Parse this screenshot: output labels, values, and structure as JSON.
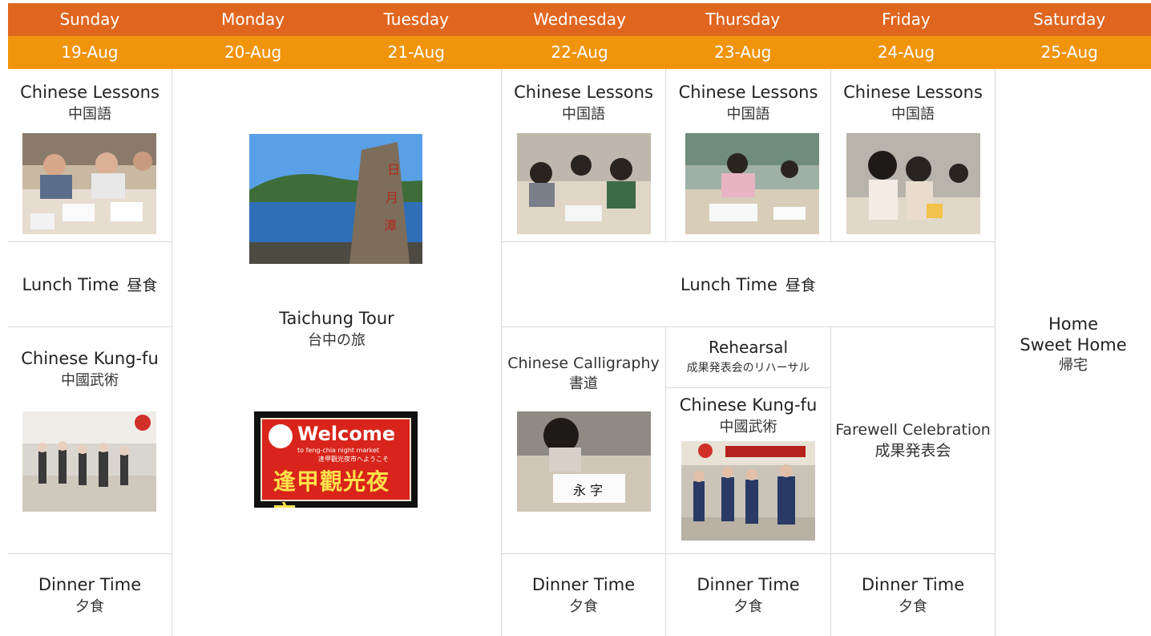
{
  "days": [
    "Sunday",
    "Monday",
    "Tuesday",
    "Wednesday",
    "Thursday",
    "Friday",
    "Saturday"
  ],
  "dates": [
    "19-Aug",
    "20-Aug",
    "21-Aug",
    "22-Aug",
    "23-Aug",
    "24-Aug",
    "25-Aug"
  ],
  "colors": {
    "day_header": "#e0661f",
    "date_header": "#f0940c",
    "grid_line": "#d8d8d8"
  },
  "sunday": {
    "lesson": {
      "en": "Chinese Lessons",
      "jp": "中国語"
    },
    "lunch": {
      "en": "Lunch Time",
      "jp": "昼食"
    },
    "kungfu": {
      "en": "Chinese Kung-fu",
      "jp": "中國武術"
    },
    "dinner": {
      "en": "Dinner Time",
      "jp": "夕食"
    }
  },
  "tour": {
    "en": "Taichung Tour",
    "jp": "台中の旅",
    "sign_top": "日月潭",
    "sign_welcome": "Welcome",
    "sign_small": "to feng-chia night market",
    "sign_small_jp": "逢甲觀光夜市へようこそ",
    "sign_big": "逢甲觀光夜市"
  },
  "lessons": {
    "wed": {
      "en": "Chinese Lessons",
      "jp": "中国語"
    },
    "thu": {
      "en": "Chinese Lessons",
      "jp": "中国語"
    },
    "fri": {
      "en": "Chinese Lessons",
      "jp": "中国語"
    }
  },
  "lunch_span": {
    "en": "Lunch Time",
    "jp": "昼食"
  },
  "calligraphy": {
    "en": "Chinese Calligraphy",
    "jp": "書道"
  },
  "rehearsal": {
    "en": "Rehearsal",
    "jp": "成果発表会のリハーサル"
  },
  "thu_kungfu": {
    "en": "Chinese Kung-fu",
    "jp": "中國武術"
  },
  "farewell": {
    "en": "Farewell Celebration",
    "jp": "成果発表会"
  },
  "dinners": {
    "wed": {
      "en": "Dinner Time",
      "jp": "夕食"
    },
    "thu": {
      "en": "Dinner Time",
      "jp": "夕食"
    },
    "fri": {
      "en": "Dinner Time",
      "jp": "夕食"
    }
  },
  "saturday": {
    "line1": "Home",
    "line2": "Sweet Home",
    "jp": "帰宅"
  }
}
